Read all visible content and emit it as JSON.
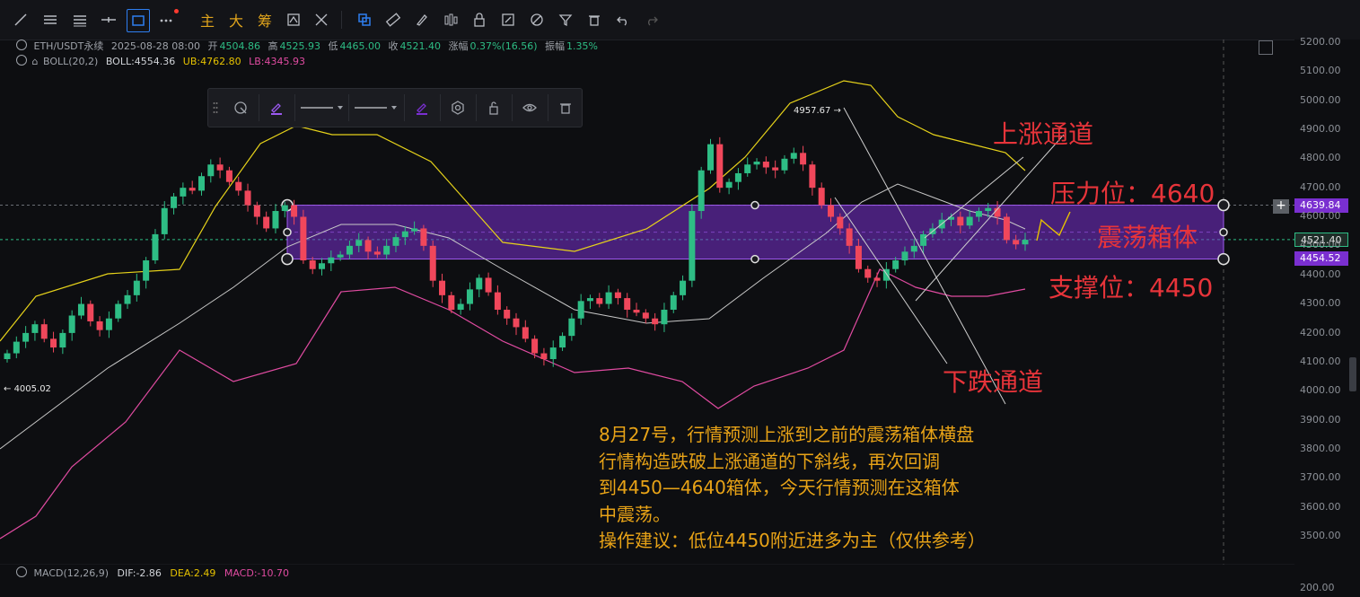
{
  "toolbar": {
    "icons": [
      "trendline-icon",
      "horizontal-lines-icon",
      "parallel-lines-icon",
      "cross-line-icon",
      "rectangle-icon",
      "more-icon"
    ],
    "zh_buttons": [
      "主",
      "大",
      "筹"
    ],
    "right_icons": [
      "magnet-icon",
      "ruler-icon",
      "brush-icon",
      "bar-pattern-icon",
      "lock-icon",
      "edit-icon",
      "palette-icon",
      "filter-icon",
      "trash-icon",
      "undo-icon",
      "redo-icon"
    ]
  },
  "info": {
    "symbol": "ETH/USDT永续",
    "datetime": "2025-08-28 08:00",
    "open_label": "开",
    "open": "4504.86",
    "high_label": "高",
    "high": "4525.93",
    "low_label": "低",
    "low": "4465.00",
    "close_label": "收",
    "close": "4521.40",
    "change_label": "涨幅",
    "change": "0.37%(16.56)",
    "amp_label": "振幅",
    "amp": "1.35%"
  },
  "boll": {
    "label": "BOLL(20,2)",
    "mid": "BOLL:4554.36",
    "ub": "UB:4762.80",
    "lb": "LB:4345.93"
  },
  "macd": {
    "label": "MACD(12,26,9)",
    "dif": "DIF:-2.86",
    "dea": "DEA:2.49",
    "macd": "MACD:-10.70"
  },
  "price_axis": {
    "ticks": [
      "5200.00",
      "5100.00",
      "5000.00",
      "4900.00",
      "4800.00",
      "4700.00",
      "4600.00",
      "4500.00",
      "4400.00",
      "4300.00",
      "4200.00",
      "4100.00",
      "4000.00",
      "3900.00",
      "3800.00",
      "3700.00",
      "3600.00",
      "3500.00"
    ],
    "macd_tick": "200.00",
    "tag_resistance": "4639.84",
    "tag_current": "4521.40",
    "tag_support": "4454.52"
  },
  "markers": {
    "high": "4957.67",
    "low": "4005.02"
  },
  "annotations": {
    "up_channel": "上涨通道",
    "down_channel": "下跌通道",
    "resistance": "压力位：4640",
    "range_box": "震荡箱体",
    "support": "支撑位：4450"
  },
  "note_lines": [
    "8月27号，行情预测上涨到之前的震荡箱体横盘",
    "行情构造跌破上涨通道的下斜线，再次回调",
    "到4450—4640箱体，今天行情预测在这箱体",
    "中震荡。",
    "操作建议：低位4450附近进多为主（仅供参考）"
  ],
  "colors": {
    "up": "#2ebd85",
    "down": "#f0475b",
    "box_fill": "#7a2fd0",
    "boll_upper": "#e6d21a",
    "boll_mid": "#c8c8c8",
    "boll_lower": "#e04ba1",
    "annotation_red": "#e7343a",
    "note_orange": "#e8a317"
  }
}
